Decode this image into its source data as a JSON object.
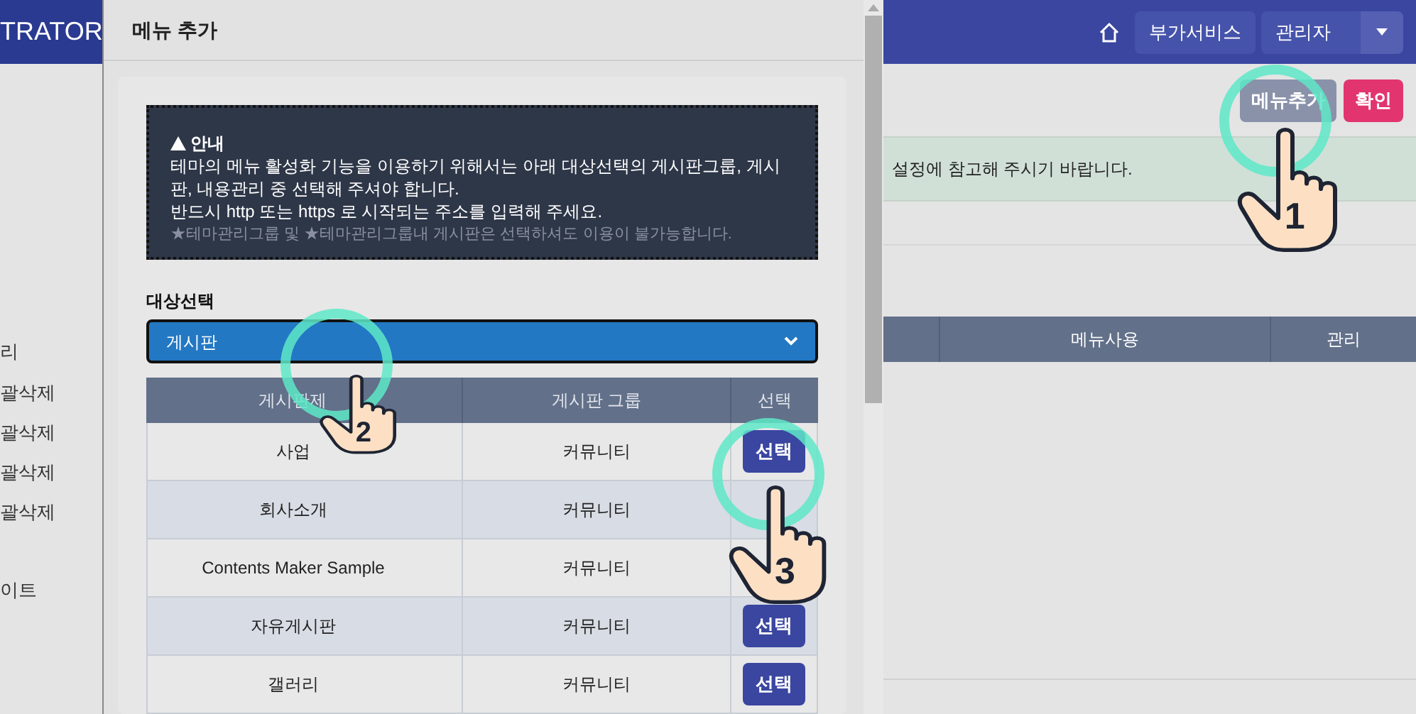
{
  "background_page": {
    "brand": "TRATOR",
    "sidebar_items": [
      "리",
      "괄삭제",
      "괄삭제",
      "괄삭제",
      "괄삭제",
      "이트"
    ],
    "header_buttons": [
      "부가서비스",
      "관리자"
    ],
    "action_buttons": [
      {
        "label": "메뉴추가",
        "kind": "secondary"
      },
      {
        "label": "확인",
        "kind": "primary"
      }
    ],
    "alert": "설정에 참고해 주시기 바랍니다.",
    "table_columns": [
      "메뉴사용",
      "관리"
    ]
  },
  "modal": {
    "title": "메뉴 추가",
    "notice": {
      "title": "안내",
      "lines": [
        "테마의 메뉴 활성화 기능을 이용하기 위해서는 아래 대상선택의 게시판그룹, 게시판, 내용관리 중 선택해 주셔야 합니다.",
        "반드시 http 또는 https 로 시작되는 주소를 입력해 주세요."
      ],
      "note": "★테마관리그룹 및 ★테마관리그룹내 게시판은 선택하셔도 이용이 불가능합니다."
    },
    "target_label": "대상선택",
    "target_value": "게시판",
    "table": {
      "columns": [
        "게시판제",
        "게시판 그룹",
        "선택"
      ],
      "rows": [
        {
          "name": "사업",
          "group": "커뮤니티",
          "button": "선택"
        },
        {
          "name": "회사소개",
          "group": "커뮤니티"
        },
        {
          "name": "Contents Maker Sample",
          "group": "커뮤니티"
        },
        {
          "name": "자유게시판",
          "group": "커뮤니티",
          "button": "선택"
        },
        {
          "name": "갤러리",
          "group": "커뮤니티",
          "button": "선택"
        }
      ]
    }
  },
  "steps": [
    {
      "number": "1"
    },
    {
      "number": "2"
    },
    {
      "number": "3"
    }
  ]
}
